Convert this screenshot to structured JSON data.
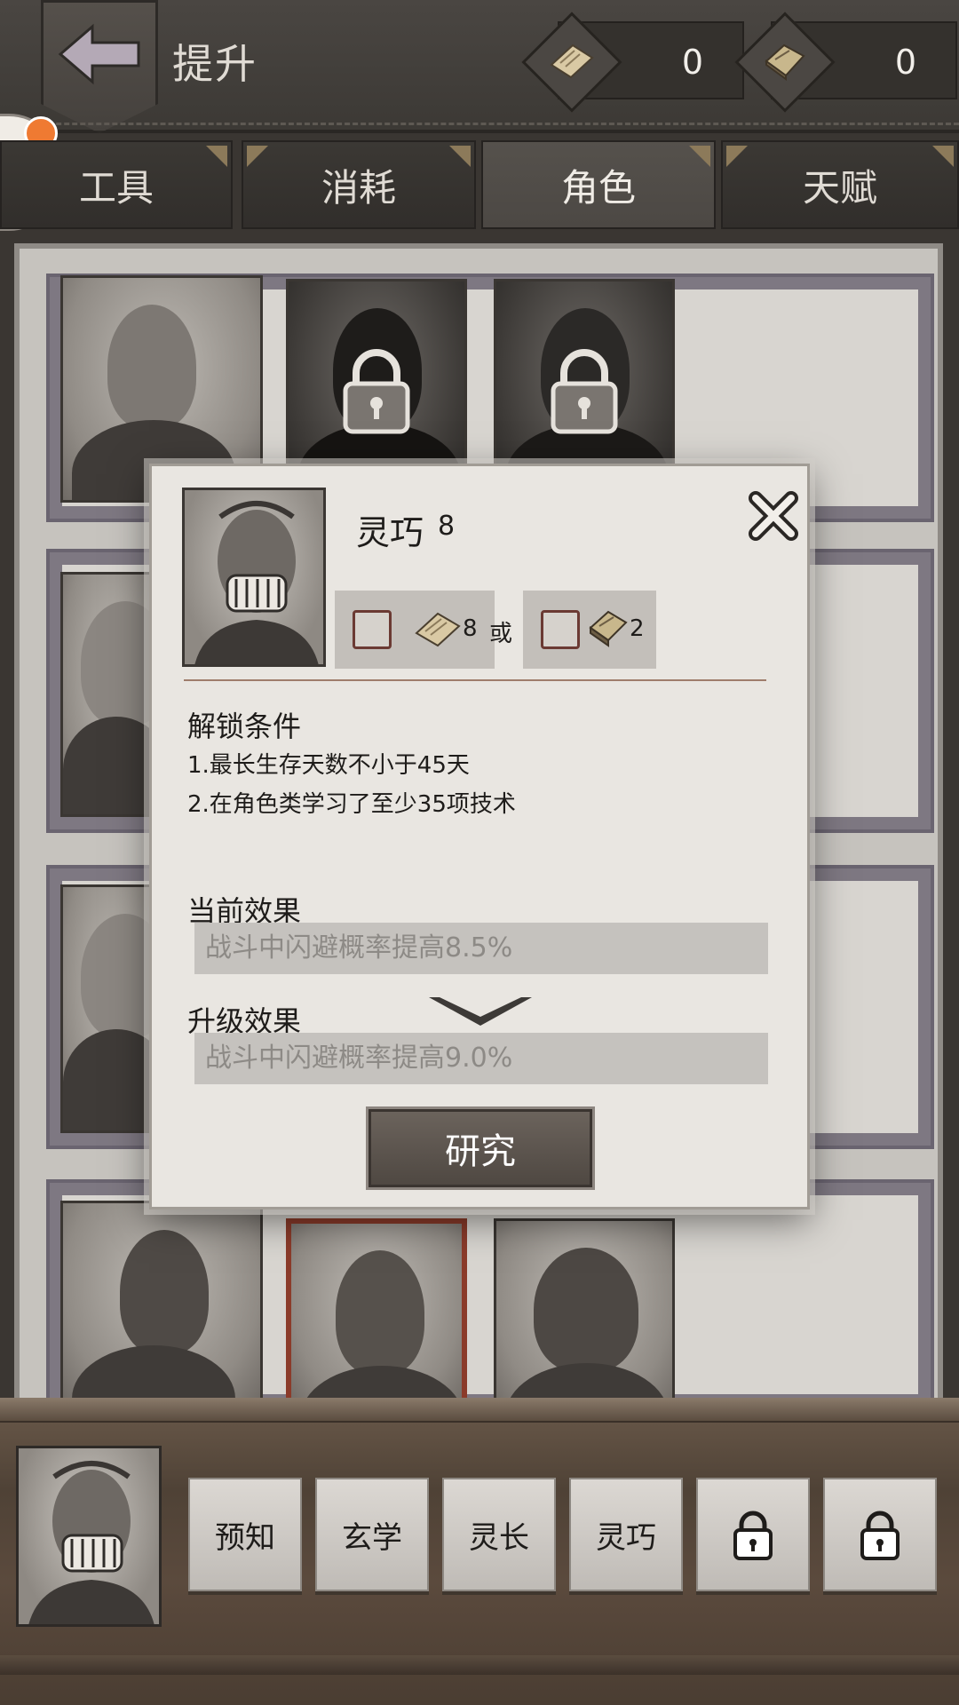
{
  "header": {
    "title": "提升",
    "currency": [
      {
        "icon": "paper-scroll-icon",
        "value": "0"
      },
      {
        "icon": "book-icon",
        "value": "0"
      }
    ]
  },
  "tabs": [
    {
      "label": "工具",
      "active": false
    },
    {
      "label": "消耗",
      "active": false
    },
    {
      "label": "角色",
      "active": true
    },
    {
      "label": "天赋",
      "active": false
    }
  ],
  "dialog": {
    "skill_name": "灵巧",
    "level": "8",
    "cost": [
      {
        "icon": "paper-scroll-icon",
        "amount": "8"
      },
      {
        "icon": "book-icon",
        "amount": "2"
      }
    ],
    "or_text": "或",
    "unlock_title": "解锁条件",
    "conditions": [
      "1.最长生存天数不小于45天",
      "2.在角色类学习了至少35项技术"
    ],
    "current_effect_title": "当前效果",
    "current_effect": "战斗中闪避概率提高8.5%",
    "upgrade_effect_title": "升级效果",
    "upgrade_effect": "战斗中闪避概率提高9.0%",
    "research_label": "研究"
  },
  "skills": [
    {
      "label": "预知",
      "locked": false
    },
    {
      "label": "玄学",
      "locked": false
    },
    {
      "label": "灵长",
      "locked": false
    },
    {
      "label": "灵巧",
      "locked": false
    },
    {
      "label": "",
      "locked": true
    },
    {
      "label": "",
      "locked": true
    }
  ],
  "colors": {
    "accent_notification": "#ef7a32",
    "selected_border": "#8b3b2a",
    "checkbox_border": "#6b3a33"
  }
}
